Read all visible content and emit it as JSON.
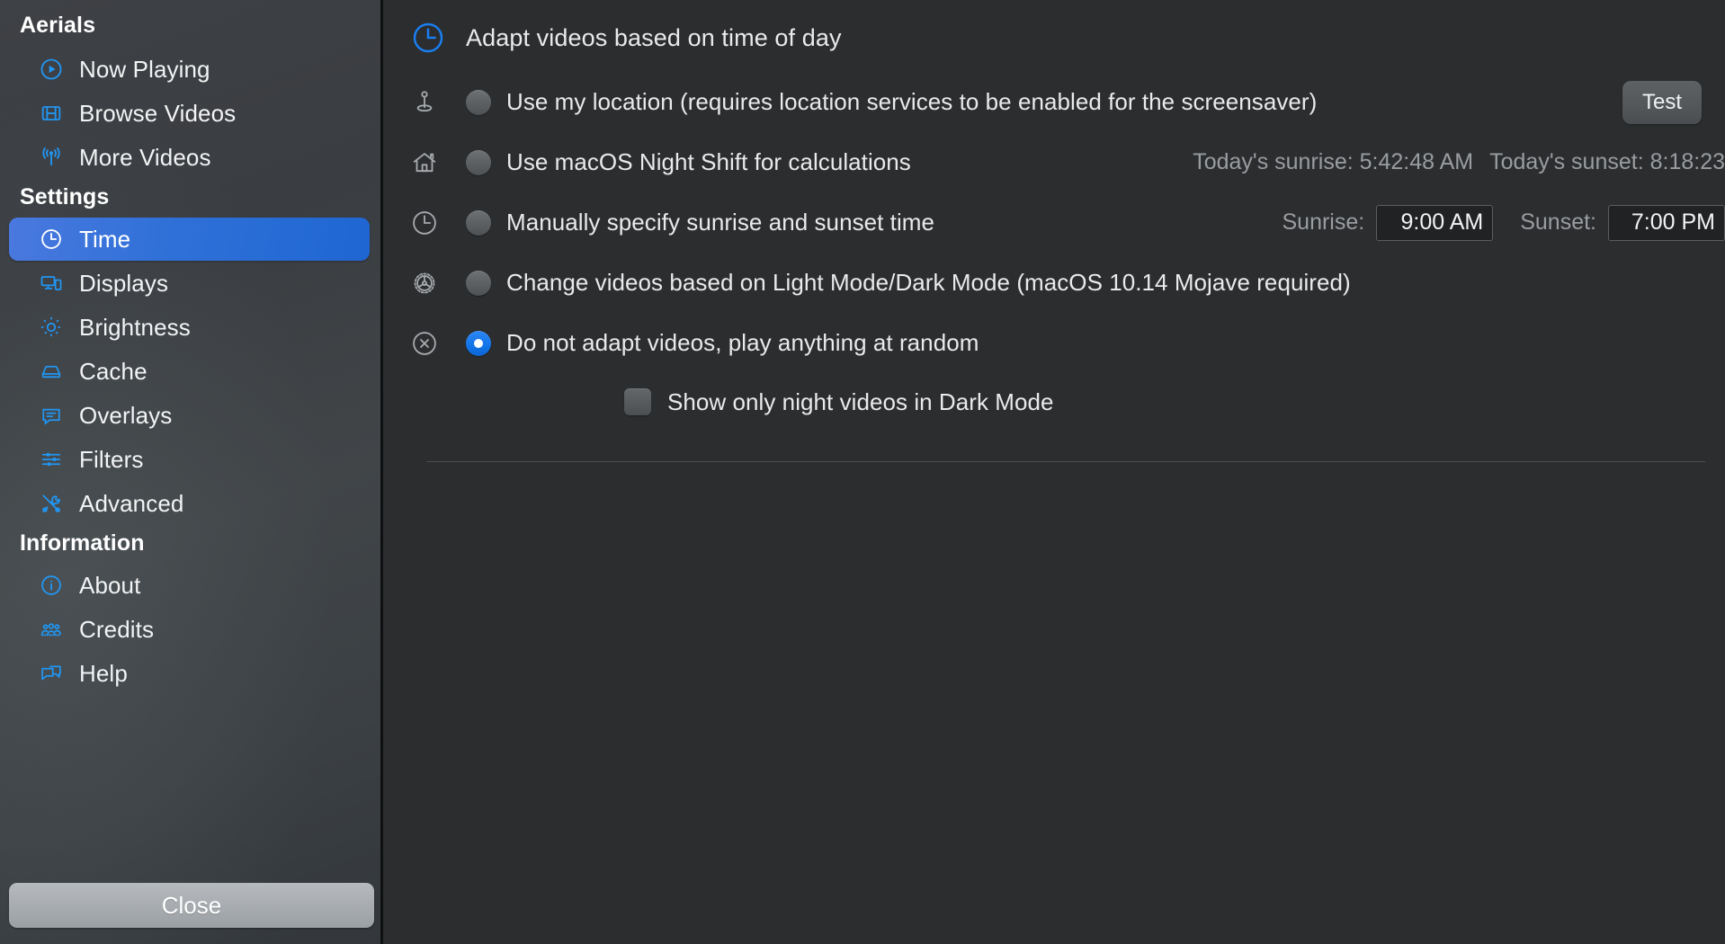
{
  "sidebar": {
    "groups": [
      {
        "title": "Aerials",
        "items": [
          {
            "label": "Now Playing",
            "icon": "play-circle-icon"
          },
          {
            "label": "Browse Videos",
            "icon": "film-icon"
          },
          {
            "label": "More Videos",
            "icon": "broadcast-icon"
          }
        ]
      },
      {
        "title": "Settings",
        "items": [
          {
            "label": "Time",
            "icon": "clock-icon",
            "selected": true
          },
          {
            "label": "Displays",
            "icon": "displays-icon"
          },
          {
            "label": "Brightness",
            "icon": "brightness-icon"
          },
          {
            "label": "Cache",
            "icon": "drive-icon"
          },
          {
            "label": "Overlays",
            "icon": "message-icon"
          },
          {
            "label": "Filters",
            "icon": "sliders-icon"
          },
          {
            "label": "Advanced",
            "icon": "tools-icon"
          }
        ]
      },
      {
        "title": "Information",
        "items": [
          {
            "label": "About",
            "icon": "info-circle-icon"
          },
          {
            "label": "Credits",
            "icon": "people-icon"
          },
          {
            "label": "Help",
            "icon": "chat-help-icon"
          }
        ]
      }
    ],
    "close_label": "Close"
  },
  "pane": {
    "title": "Adapt videos based on time of day",
    "header_icon": "clock-icon",
    "options": [
      {
        "id": "use-my-location",
        "icon": "location-pin-icon",
        "label": "Use my location (requires location services to be enabled for the screensaver)",
        "selected": false,
        "test_label": "Test"
      },
      {
        "id": "use-night-shift",
        "icon": "house-icon",
        "label": "Use macOS Night Shift for calculations",
        "selected": false,
        "sunrise_info": "Today's sunrise: 5:42:48 AM",
        "sunset_info": "Today's sunset: 8:18:23"
      },
      {
        "id": "manual-sunrise-sunset",
        "icon": "clock-icon",
        "label": "Manually specify sunrise and sunset time",
        "selected": false,
        "sunrise_label": "Sunrise:",
        "sunrise_value": "9:00 AM",
        "sunset_label": "Sunset:",
        "sunset_value": "7:00 PM"
      },
      {
        "id": "light-dark-mode",
        "icon": "gear-icon",
        "label": "Change videos based on Light Mode/Dark Mode (macOS 10.14 Mojave required)",
        "selected": false
      },
      {
        "id": "do-not-adapt",
        "icon": "x-circle-icon",
        "label": "Do not adapt videos, play anything at random",
        "selected": true
      }
    ],
    "checkbox": {
      "label": "Show only night videos in Dark Mode",
      "checked": false
    }
  },
  "colors": {
    "accent_blue": "#2196f3",
    "selection_blue": "#2d74d8",
    "sidebar_bg": "#3b3f43",
    "content_bg": "#2b2d2f",
    "text_primary": "#e9eaeb",
    "text_muted": "#9a9da0"
  }
}
